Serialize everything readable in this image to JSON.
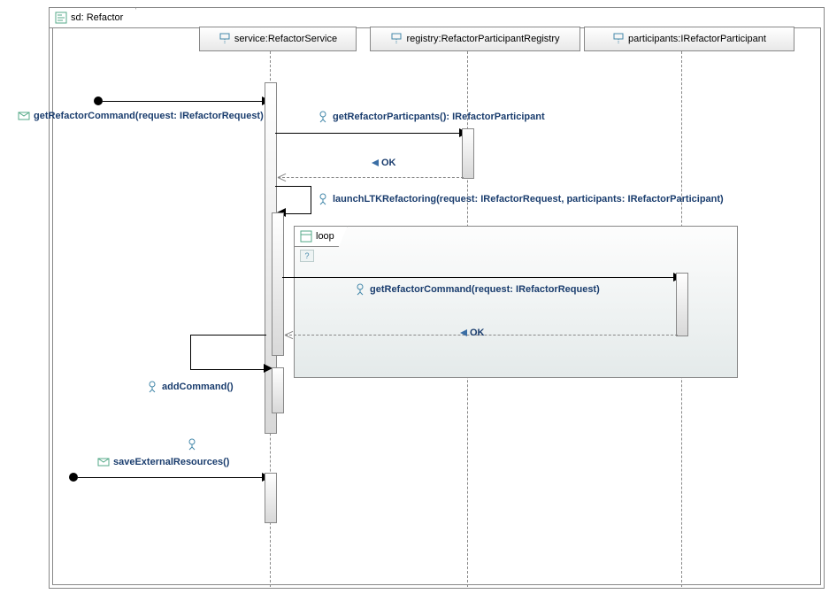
{
  "frame": {
    "label": "sd: Refactor"
  },
  "lifelines": {
    "service": "service:RefactorService",
    "registry": "registry:RefactorParticipantRegistry",
    "participants": "participants:IRefactorParticipant"
  },
  "messages": {
    "getRefactorCommand": "getRefactorCommand(request: IRefactorRequest)",
    "getRefactorParticipants": "getRefactorParticpants(): IRefactorParticipant",
    "ok1": "OK",
    "launchLTK": "launchLTKRefactoring(request: IRefactorRequest, participants: IRefactorParticipant)",
    "getRefactorCommand2": "getRefactorCommand(request: IRefactorRequest)",
    "ok2": "OK",
    "addCommand": "addCommand()",
    "saveExternalResources": "saveExternalResources()"
  },
  "fragments": {
    "loop": "loop"
  }
}
